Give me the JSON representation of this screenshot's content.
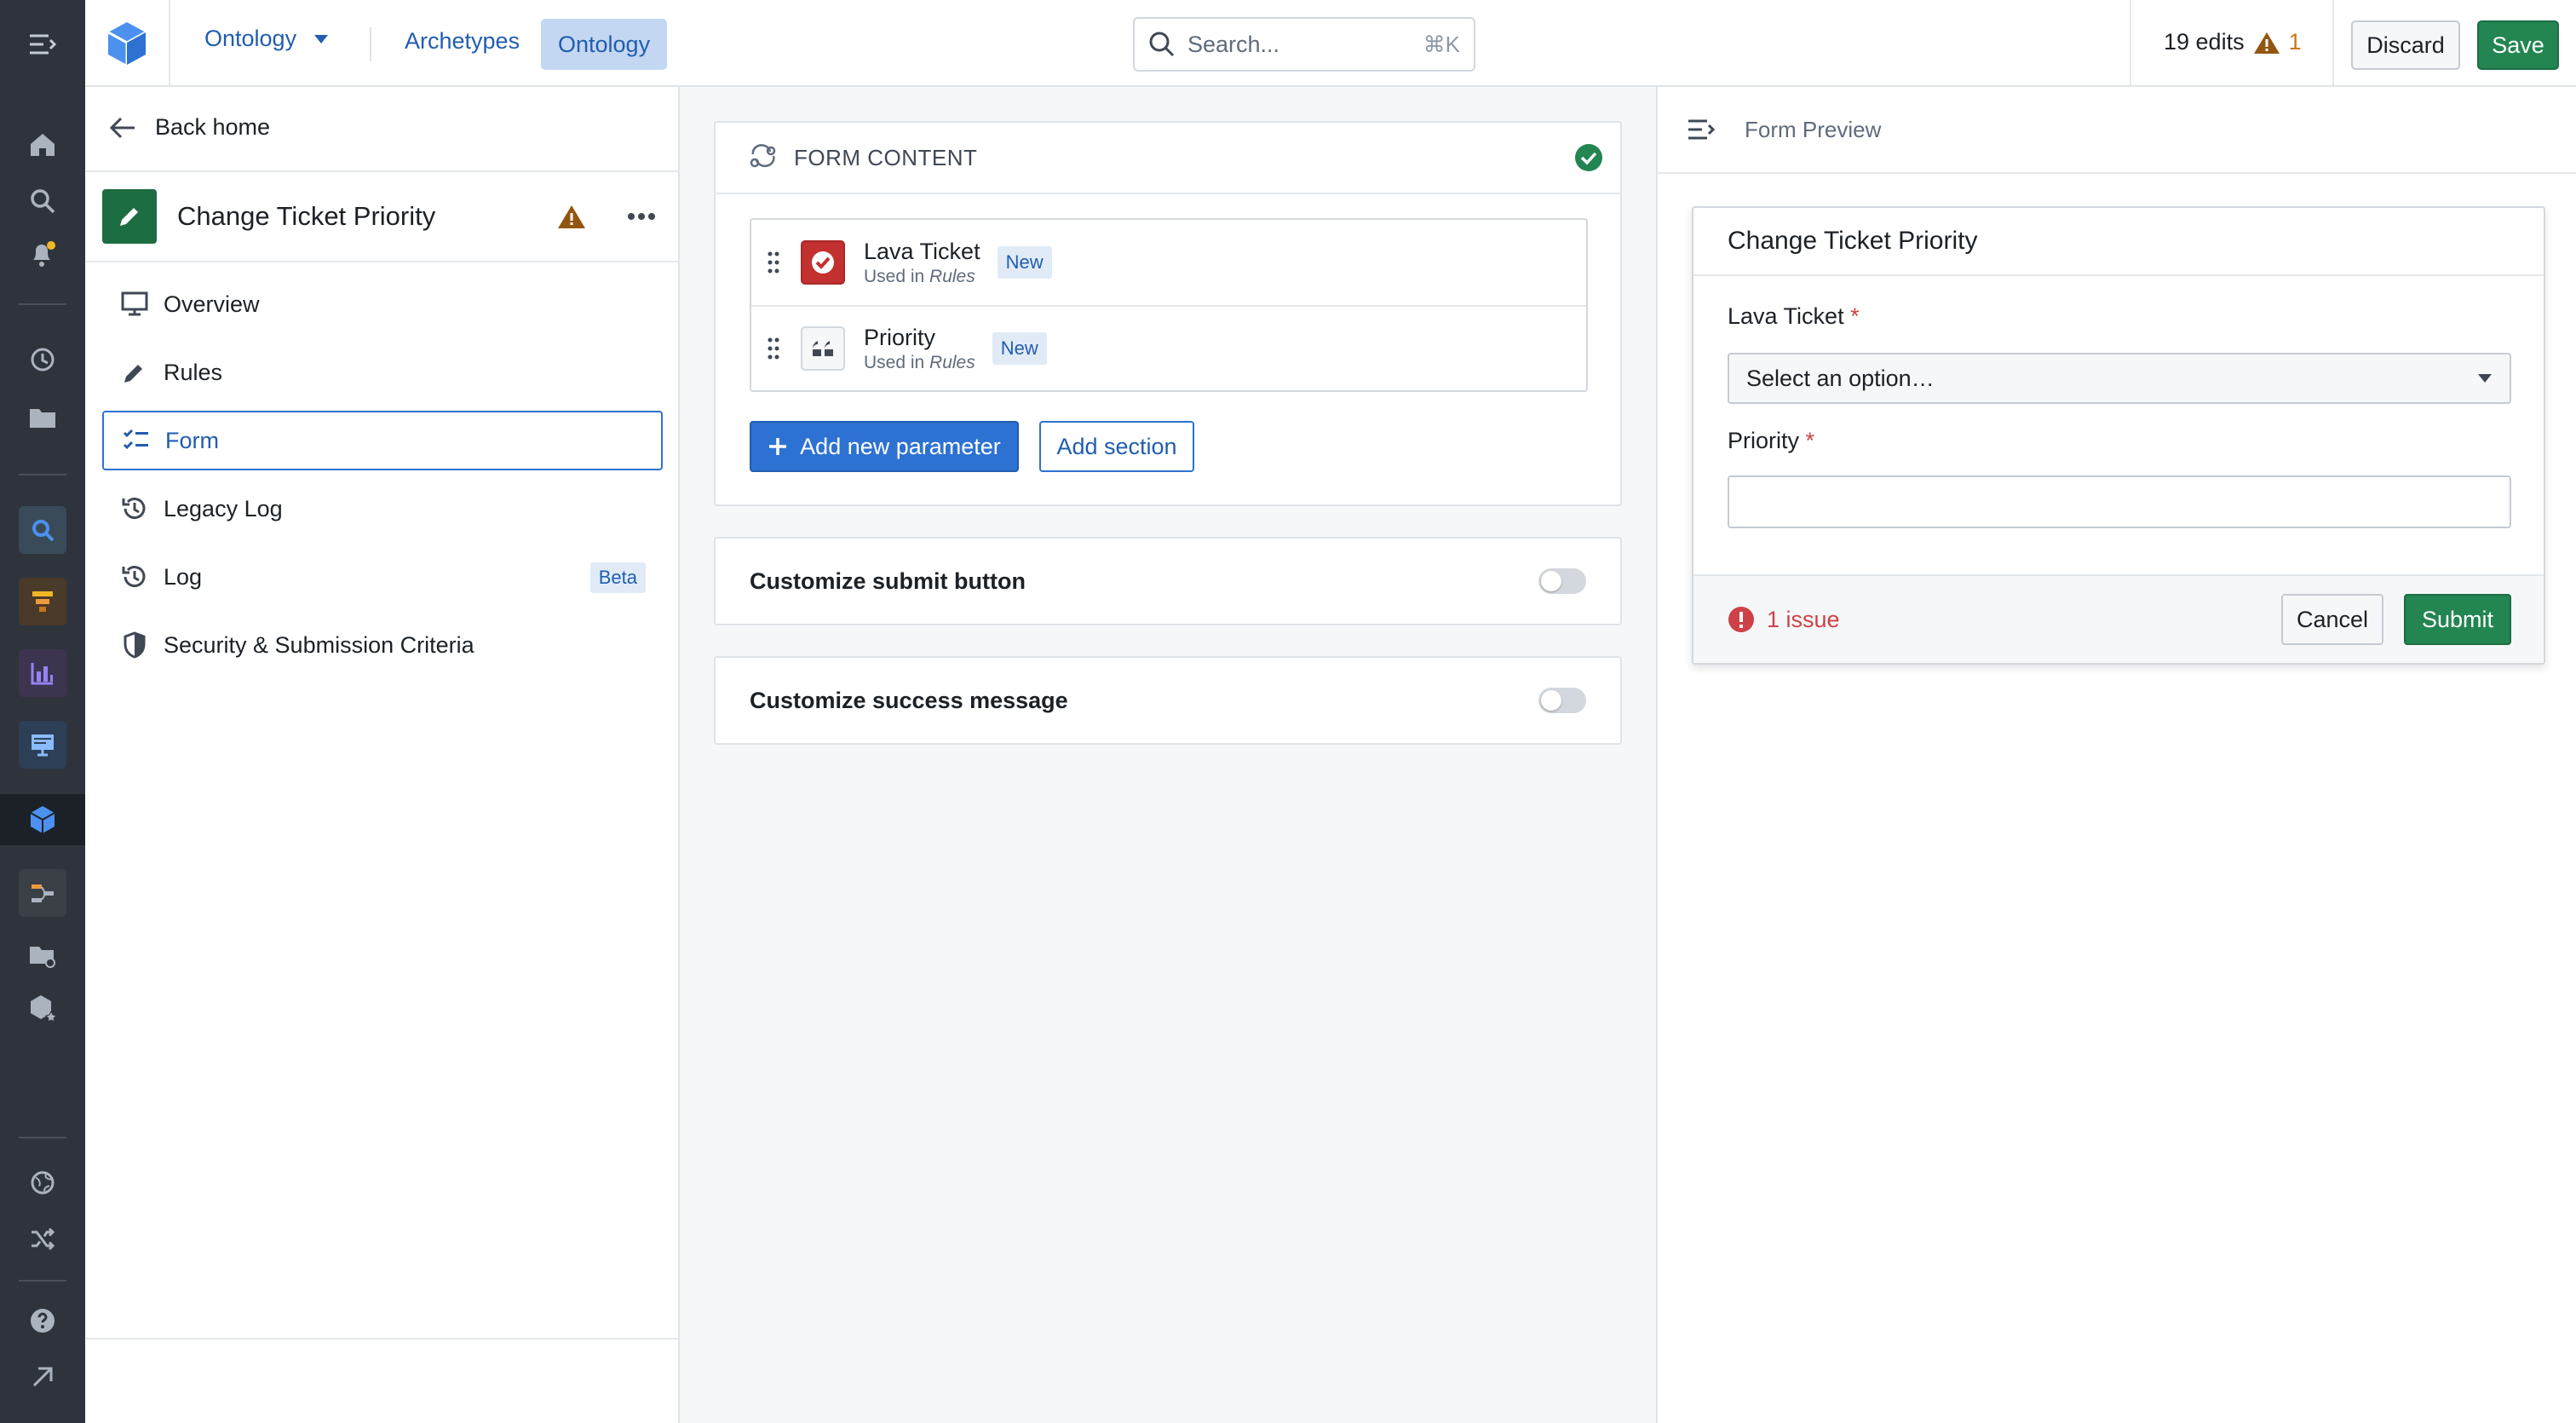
{
  "colors": {
    "rail_bg": "#2f343c",
    "primary_blue": "#2d72d2",
    "success_green": "#238551",
    "danger_red": "#cd4246",
    "warning_orange": "#c87619"
  },
  "rail": {
    "icons": [
      "menu-expand-icon",
      "home-icon",
      "search-icon",
      "notifications-icon",
      "history-icon",
      "folder-icon",
      "object-explorer-icon",
      "pipeline-icon",
      "chart-icon",
      "workshop-icon",
      "ontology-cube-icon",
      "data-lineage-icon",
      "folder-share-icon",
      "cube-star-icon",
      "globe-icon",
      "shuffle-icon",
      "help-icon",
      "external-link-icon"
    ]
  },
  "topbar": {
    "ontology_dropdown": "Ontology",
    "archetypes": "Archetypes",
    "ontology_tab": "Ontology",
    "search_placeholder": "Search...",
    "search_shortcut": "⌘K",
    "edits": "19 edits",
    "warning_count": "1",
    "discard": "Discard",
    "save": "Save"
  },
  "left_panel": {
    "back": "Back home",
    "action_title": "Change Ticket Priority",
    "menu": [
      {
        "label": "Overview",
        "icon": "desktop-icon"
      },
      {
        "label": "Rules",
        "icon": "pencil-icon"
      },
      {
        "label": "Form",
        "icon": "form-icon",
        "active": true
      },
      {
        "label": "Legacy Log",
        "icon": "history-icon"
      },
      {
        "label": "Log",
        "icon": "history-icon",
        "badge": "Beta"
      },
      {
        "label": "Security & Submission Criteria",
        "icon": "shield-icon"
      }
    ]
  },
  "form_content": {
    "title": "FORM CONTENT",
    "parameters": [
      {
        "name": "Lava Ticket",
        "used_prefix": "Used in",
        "used_in": "Rules",
        "tag": "New",
        "icon": "object-icon"
      },
      {
        "name": "Priority",
        "used_prefix": "Used in",
        "used_in": "Rules",
        "tag": "New",
        "icon": "quote-icon"
      }
    ],
    "add_parameter": "Add new parameter",
    "add_section": "Add section"
  },
  "toggles": {
    "submit_button": "Customize submit button",
    "success_message": "Customize success message"
  },
  "preview": {
    "header": "Form Preview",
    "form_title": "Change Ticket Priority",
    "field1_label": "Lava Ticket",
    "field1_placeholder": "Select an option…",
    "field2_label": "Priority",
    "required_mark": "*",
    "issues": "1 issue",
    "cancel": "Cancel",
    "submit": "Submit"
  }
}
